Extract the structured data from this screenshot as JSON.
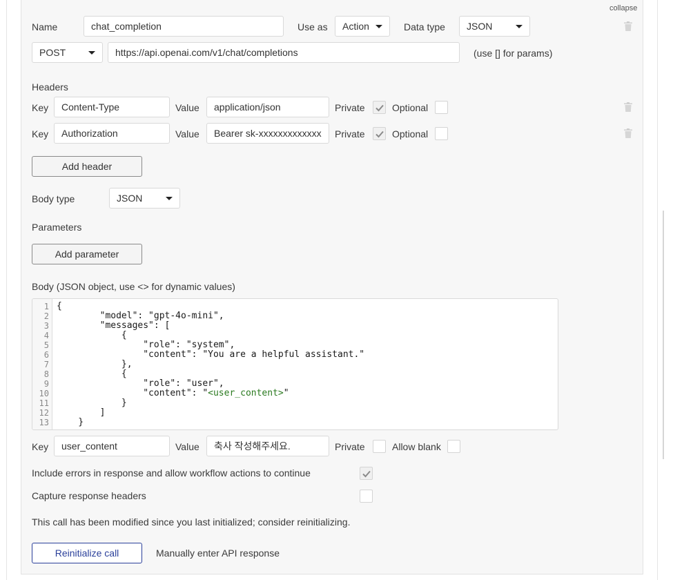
{
  "header": {
    "collapse_label": "collapse"
  },
  "call": {
    "name_label": "Name",
    "name_value": "chat_completion",
    "use_as_label": "Use as",
    "use_as_value": "Action",
    "data_type_label": "Data type",
    "data_type_value": "JSON",
    "method_value": "POST",
    "url_value": "https://api.openai.com/v1/chat/completions",
    "url_hint": "(use [] for params)"
  },
  "headers_section": {
    "title": "Headers",
    "key_label": "Key",
    "value_label": "Value",
    "private_label": "Private",
    "optional_label": "Optional",
    "rows": [
      {
        "key": "Content-Type",
        "value": "application/json",
        "private": true,
        "optional": false
      },
      {
        "key": "Authorization",
        "value": "Bearer sk-xxxxxxxxxxxxx",
        "private": true,
        "optional": false
      }
    ],
    "add_button": "Add header"
  },
  "body_type": {
    "label": "Body type",
    "value": "JSON"
  },
  "parameters": {
    "title": "Parameters",
    "add_button": "Add parameter"
  },
  "body": {
    "label": "Body (JSON object, use <> for dynamic values)",
    "line_numbers": [
      "1",
      "2",
      "3",
      "4",
      "5",
      "6",
      "7",
      "8",
      "9",
      "10",
      "11",
      "12",
      "13"
    ],
    "lines": [
      "{",
      "        \"model\": \"gpt-4o-mini\",",
      "        \"messages\": [",
      "            {",
      "                \"role\": \"system\",",
      "                \"content\": \"You are a helpful assistant.\"",
      "            },",
      "            {",
      "                \"role\": \"user\",",
      "                \"content\": \"",
      "            }",
      "        ]",
      "    }"
    ],
    "dynamic_token": "<user_content>",
    "dynamic_suffix": "\""
  },
  "dynamic_param": {
    "key_label": "Key",
    "key_value": "user_content",
    "value_label": "Value",
    "value_value": "축사 작성해주세요.",
    "private_label": "Private",
    "allow_blank_label": "Allow blank"
  },
  "options": {
    "include_errors_label": "Include errors in response and allow workflow actions to continue",
    "include_errors_checked": true,
    "capture_headers_label": "Capture response headers",
    "capture_headers_checked": false
  },
  "notice": "This call has been modified since you last initialized; consider reinitializing.",
  "footer": {
    "reinitialize_button": "Reinitialize call",
    "manual_link": "Manually enter API response"
  },
  "colors": {
    "panel_bg": "#f7f7f7",
    "primary_button_border": "#2a3f9a",
    "dynamic_token": "#2a7a1f"
  }
}
